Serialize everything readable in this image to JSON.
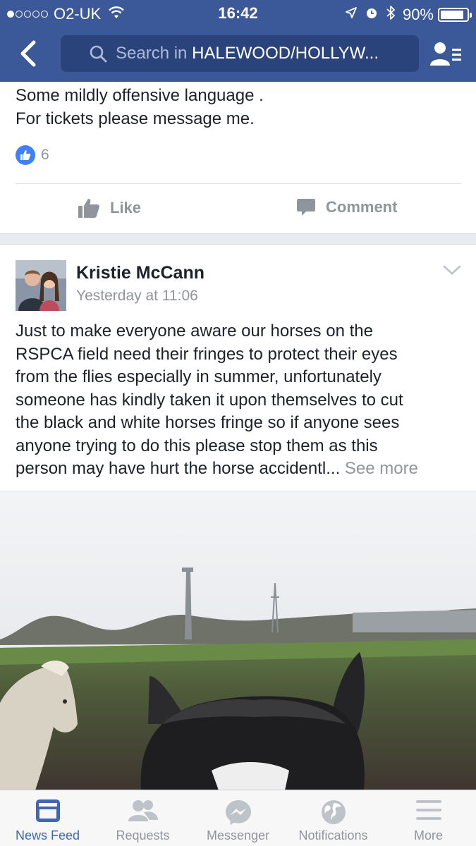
{
  "status_bar": {
    "carrier": "O2-UK",
    "time": "16:42",
    "battery_percent": "90%",
    "battery_level": 0.9
  },
  "nav": {
    "search_prefix": "Search in ",
    "search_group": "HALEWOOD/HOLLYW..."
  },
  "post1": {
    "lines": [
      "Some mildly offensive language .",
      "For tickets please message me."
    ],
    "like_count": "6",
    "like_label": "Like",
    "comment_label": "Comment"
  },
  "post2": {
    "author": "Kristie McCann",
    "timestamp": "Yesterday at 11:06",
    "lines": [
      "Just to make everyone aware our horses on the",
      "RSPCA field need their fringes to protect their eyes",
      "from the flies especially in summer, unfortunately",
      "someone has kindly taken it upon themselves to cut",
      "the black and white horses fringe so if anyone sees",
      "anyone trying to do this please stop them as this",
      "person may have hurt the horse accidentl... "
    ],
    "see_more": "See more"
  },
  "tabs": [
    {
      "label": "News Feed",
      "icon": "news-feed-icon",
      "active": true
    },
    {
      "label": "Requests",
      "icon": "friend-requests-icon",
      "active": false
    },
    {
      "label": "Messenger",
      "icon": "messenger-icon",
      "active": false
    },
    {
      "label": "Notifications",
      "icon": "globe-icon",
      "active": false
    },
    {
      "label": "More",
      "icon": "hamburger-menu-icon",
      "active": false
    }
  ],
  "colors": {
    "brand_blue": "#3b5998",
    "active_tab": "#4267b2",
    "muted_text": "#90949c"
  }
}
